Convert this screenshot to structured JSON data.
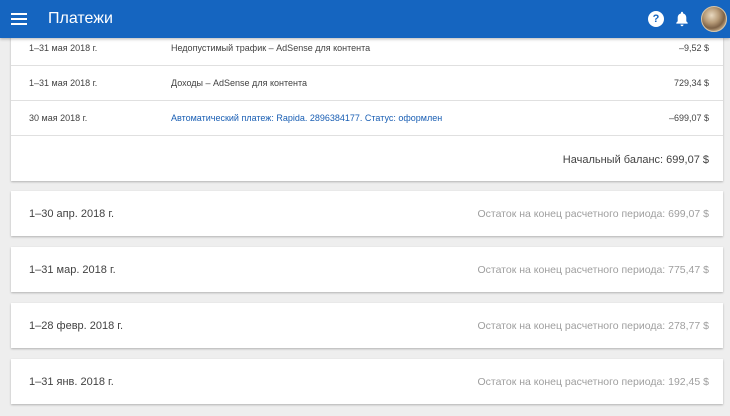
{
  "appbar": {
    "title": "Платежи",
    "menu_icon": "menu-icon",
    "help_icon": "help-icon",
    "help_glyph": "?",
    "bell_icon": "bell-icon",
    "brand_color": "#1565c0"
  },
  "transactions": [
    {
      "date": "1–31 мая 2018 г.",
      "description": "Недопустимый трафик – AdSense для контента",
      "amount": "–9,52 $",
      "link": false
    },
    {
      "date": "1–31 мая 2018 г.",
      "description": "Доходы – AdSense для контента",
      "amount": "729,34 $",
      "link": false
    },
    {
      "date": "30 мая 2018 г.",
      "description": "Автоматический платеж: Rapida. 2896384177. Статус: оформлен",
      "amount": "–699,07 $",
      "link": true
    }
  ],
  "opening_balance": "Начальный баланс: 699,07 $",
  "periods": [
    {
      "date": "1–30 апр. 2018 г.",
      "balance": "Остаток на конец расчетного периода: 699,07 $"
    },
    {
      "date": "1–31 мар. 2018 г.",
      "balance": "Остаток на конец расчетного периода: 775,47 $"
    },
    {
      "date": "1–28 февр. 2018 г.",
      "balance": "Остаток на конец расчетного периода: 278,77 $"
    },
    {
      "date": "1–31 янв. 2018 г.",
      "balance": "Остаток на конец расчетного периода: 192,45 $"
    }
  ]
}
